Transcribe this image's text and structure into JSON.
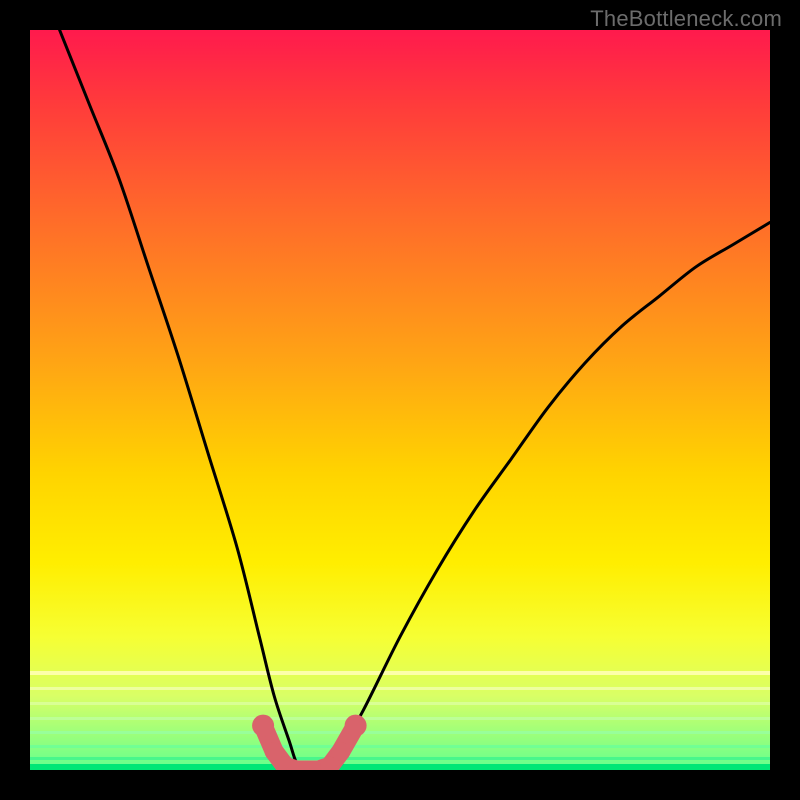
{
  "watermark": "TheBottleneck.com",
  "chart_data": {
    "type": "line",
    "title": "",
    "xlabel": "",
    "ylabel": "",
    "xlim": [
      0,
      100
    ],
    "ylim": [
      0,
      100
    ],
    "grid": false,
    "series": [
      {
        "name": "bottleneck-curve",
        "x": [
          4,
          8,
          12,
          16,
          20,
          24,
          28,
          31,
          33,
          35,
          36,
          37,
          38,
          39,
          40,
          42,
          45,
          50,
          55,
          60,
          65,
          70,
          75,
          80,
          85,
          90,
          95,
          100
        ],
        "y": [
          100,
          90,
          80,
          68,
          56,
          43,
          30,
          18,
          10,
          4,
          1,
          0,
          0,
          0,
          1,
          3,
          8,
          18,
          27,
          35,
          42,
          49,
          55,
          60,
          64,
          68,
          71,
          74
        ]
      }
    ],
    "markers": {
      "name": "bottom-dots",
      "color": "#d9636b",
      "points": [
        {
          "x": 31.5,
          "y": 6
        },
        {
          "x": 33,
          "y": 2.5
        },
        {
          "x": 34.5,
          "y": 0.5
        },
        {
          "x": 36,
          "y": 0
        },
        {
          "x": 37.5,
          "y": 0
        },
        {
          "x": 39,
          "y": 0
        },
        {
          "x": 40.5,
          "y": 0.5
        },
        {
          "x": 42,
          "y": 2.5
        },
        {
          "x": 44,
          "y": 6
        }
      ]
    },
    "gradient_stops": [
      {
        "pct": 0,
        "color": "#ff1a4d"
      },
      {
        "pct": 25,
        "color": "#ff6a2a"
      },
      {
        "pct": 60,
        "color": "#ffd400"
      },
      {
        "pct": 82,
        "color": "#f6ff33"
      },
      {
        "pct": 100,
        "color": "#00e676"
      }
    ]
  }
}
